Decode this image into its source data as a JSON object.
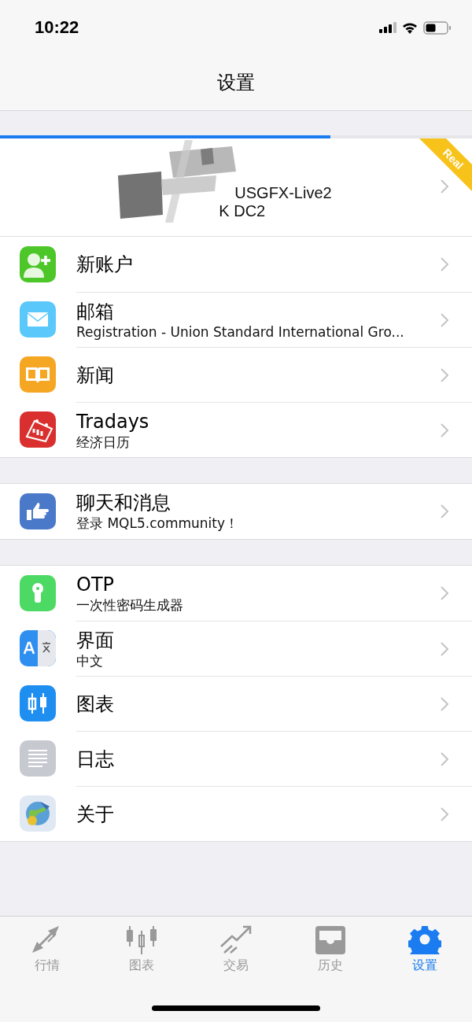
{
  "status_bar": {
    "time": "10:22"
  },
  "nav": {
    "title": "设置"
  },
  "account": {
    "level": 0.7,
    "badge": "Real",
    "server": "USGFX-Live2",
    "datacenter": "K DC2"
  },
  "sections": [
    {
      "items": [
        {
          "kind": "new-account",
          "title": "新账户"
        },
        {
          "kind": "mail",
          "title": "邮箱",
          "subtitle": "Registration - Union Standard International Gro..."
        },
        {
          "kind": "news",
          "title": "新闻"
        },
        {
          "kind": "calendar",
          "title": "Tradays",
          "subtitle": "经济日历"
        }
      ]
    },
    {
      "items": [
        {
          "kind": "chat",
          "title": "聊天和消息",
          "subtitle": "登录 MQL5.community！"
        }
      ]
    },
    {
      "items": [
        {
          "kind": "otp",
          "title": "OTP",
          "subtitle": "一次性密码生成器"
        },
        {
          "kind": "language",
          "title": "界面",
          "subtitle": "中文"
        },
        {
          "kind": "charts",
          "title": "图表"
        },
        {
          "kind": "journal",
          "title": "日志"
        },
        {
          "kind": "about",
          "title": "关于"
        }
      ]
    }
  ],
  "tab_bar": [
    {
      "kind": "quotes",
      "label": "行情",
      "selected": false
    },
    {
      "kind": "chart",
      "label": "图表",
      "selected": false
    },
    {
      "kind": "trade",
      "label": "交易",
      "selected": false
    },
    {
      "kind": "history",
      "label": "历史",
      "selected": false
    },
    {
      "kind": "settings",
      "label": "设置",
      "selected": true
    }
  ]
}
